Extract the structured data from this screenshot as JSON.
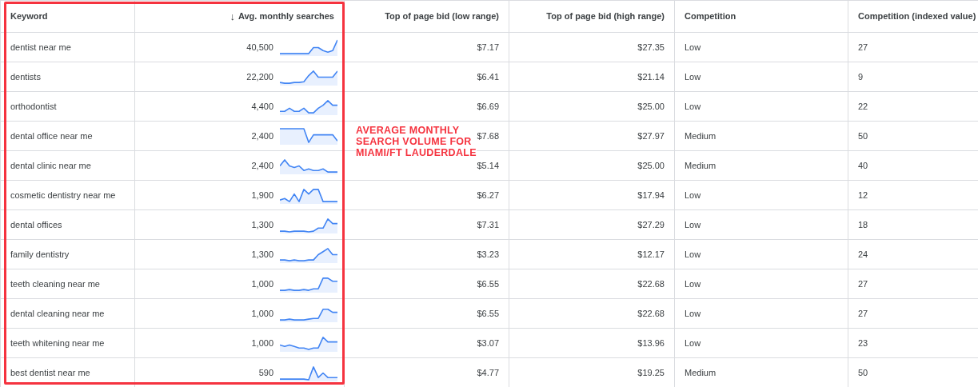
{
  "table": {
    "columns": [
      {
        "label": "Keyword"
      },
      {
        "label": "Avg. monthly searches",
        "sort_arrow": "↓"
      },
      {
        "label": "Top of page bid (low range)"
      },
      {
        "label": "Top of page bid (high range)"
      },
      {
        "label": "Competition"
      },
      {
        "label": "Competition (indexed value)"
      }
    ],
    "rows": [
      {
        "keyword": "dentist near me",
        "searches": "40,500",
        "bid_low": "$7.17",
        "bid_high": "$27.35",
        "competition": "Low",
        "index": "27"
      },
      {
        "keyword": "dentists",
        "searches": "22,200",
        "bid_low": "$6.41",
        "bid_high": "$21.14",
        "competition": "Low",
        "index": "9"
      },
      {
        "keyword": "orthodontist",
        "searches": "4,400",
        "bid_low": "$6.69",
        "bid_high": "$25.00",
        "competition": "Low",
        "index": "22"
      },
      {
        "keyword": "dental office near me",
        "searches": "2,400",
        "bid_low": "$7.68",
        "bid_high": "$27.97",
        "competition": "Medium",
        "index": "50"
      },
      {
        "keyword": "dental clinic near me",
        "searches": "2,400",
        "bid_low": "$5.14",
        "bid_high": "$25.00",
        "competition": "Medium",
        "index": "40"
      },
      {
        "keyword": "cosmetic dentistry near me",
        "searches": "1,900",
        "bid_low": "$6.27",
        "bid_high": "$17.94",
        "competition": "Low",
        "index": "12"
      },
      {
        "keyword": "dental offices",
        "searches": "1,300",
        "bid_low": "$7.31",
        "bid_high": "$27.29",
        "competition": "Low",
        "index": "18"
      },
      {
        "keyword": "family dentistry",
        "searches": "1,300",
        "bid_low": "$3.23",
        "bid_high": "$12.17",
        "competition": "Low",
        "index": "24"
      },
      {
        "keyword": "teeth cleaning near me",
        "searches": "1,000",
        "bid_low": "$6.55",
        "bid_high": "$22.68",
        "competition": "Low",
        "index": "27"
      },
      {
        "keyword": "dental cleaning near me",
        "searches": "1,000",
        "bid_low": "$6.55",
        "bid_high": "$22.68",
        "competition": "Low",
        "index": "27"
      },
      {
        "keyword": "teeth whitening near me",
        "searches": "1,000",
        "bid_low": "$3.07",
        "bid_high": "$13.96",
        "competition": "Low",
        "index": "23"
      },
      {
        "keyword": "best dentist near me",
        "searches": "590",
        "bid_low": "$4.77",
        "bid_high": "$19.25",
        "competition": "Medium",
        "index": "50"
      }
    ]
  },
  "annotation": {
    "lines": [
      "AVERAGE MONTHLY",
      "SEARCH VOLUME FOR",
      "MIAMI/FT LAUDERDALE"
    ]
  }
}
